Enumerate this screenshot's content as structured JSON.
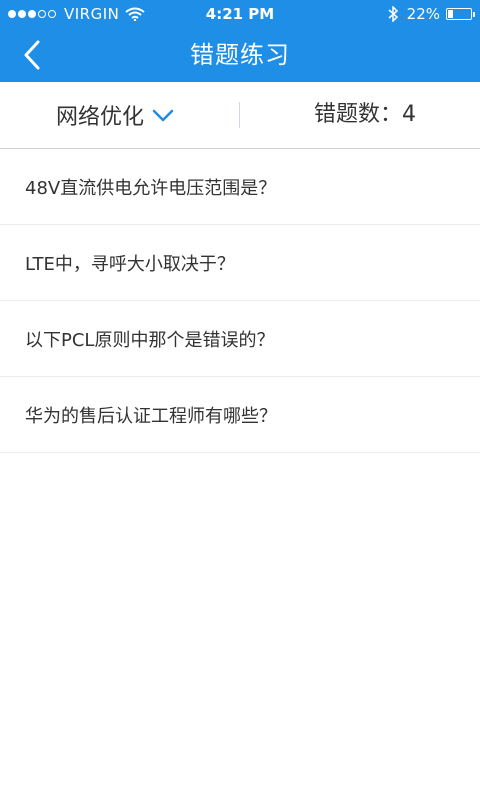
{
  "status_bar": {
    "carrier": "VIRGIN",
    "time": "4:21 PM",
    "battery_percent": "22%"
  },
  "nav": {
    "title": "错题练习"
  },
  "filter": {
    "category": "网络优化",
    "count_label": "错题数：4"
  },
  "questions": [
    {
      "text": "48V直流供电允许电压范围是？"
    },
    {
      "text": "LTE中，寻呼大小取决于？"
    },
    {
      "text": "以下PCL原则中那个是错误的？"
    },
    {
      "text": "华为的售后认证工程师有哪些？"
    }
  ],
  "colors": {
    "header_bg": "#1e8ee6",
    "accent": "#1e8ee6"
  }
}
